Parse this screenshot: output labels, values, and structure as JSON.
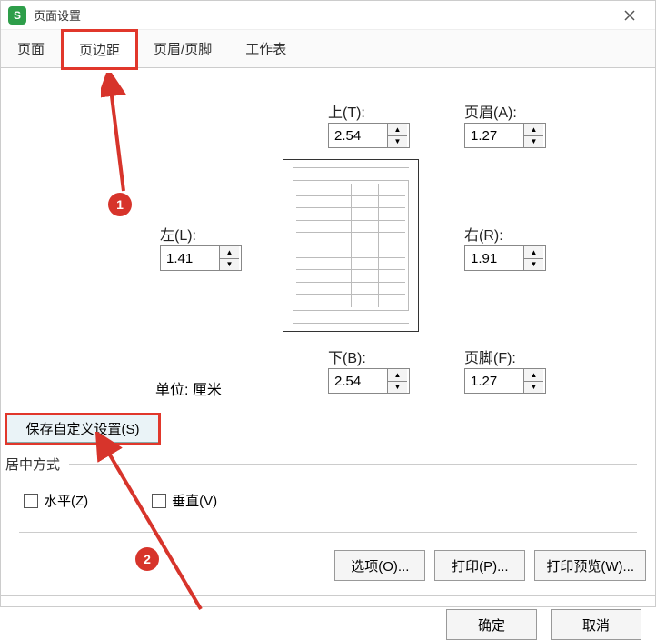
{
  "titlebar": {
    "title": "页面设置"
  },
  "tabs": {
    "page": "页面",
    "margins": "页边距",
    "hf": "页眉/页脚",
    "sheet": "工作表"
  },
  "margins": {
    "top_label": "上(T):",
    "top_value": "2.54",
    "header_label": "页眉(A):",
    "header_value": "1.27",
    "left_label": "左(L):",
    "left_value": "1.41",
    "right_label": "右(R):",
    "right_value": "1.91",
    "bottom_label": "下(B):",
    "bottom_value": "2.54",
    "footer_label": "页脚(F):",
    "footer_value": "1.27"
  },
  "unit": "单位: 厘米",
  "save_custom": "保存自定义设置(S)",
  "center_group": "居中方式",
  "center": {
    "horizontal": "水平(Z)",
    "vertical": "垂直(V)"
  },
  "buttons": {
    "options": "选项(O)...",
    "print": "打印(P)...",
    "preview": "打印预览(W)...",
    "ok": "确定",
    "cancel": "取消"
  },
  "annotations": {
    "badge1": "1",
    "badge2": "2"
  }
}
